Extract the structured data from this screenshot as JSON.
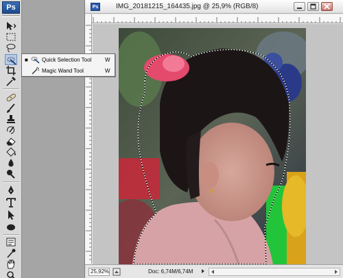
{
  "app": {
    "logo": "Ps"
  },
  "toolbox": {
    "tools": [
      {
        "name": "move-tool",
        "icon": "move-icon"
      },
      {
        "name": "marquee-tool",
        "icon": "rect-marquee-icon"
      },
      {
        "name": "lasso-tool",
        "icon": "lasso-icon"
      },
      {
        "name": "quick-selection-tool",
        "icon": "quick-selection-icon",
        "active": true
      },
      {
        "name": "crop-tool",
        "icon": "crop-icon"
      },
      {
        "name": "eyedropper-tool",
        "icon": "eyedropper-icon"
      },
      {
        "name": "spot-healing-tool",
        "icon": "bandage-icon"
      },
      {
        "name": "brush-tool",
        "icon": "brush-icon"
      },
      {
        "name": "clone-stamp-tool",
        "icon": "stamp-icon"
      },
      {
        "name": "history-brush-tool",
        "icon": "history-brush-icon"
      },
      {
        "name": "eraser-tool",
        "icon": "eraser-icon"
      },
      {
        "name": "paint-bucket-tool",
        "icon": "bucket-icon"
      },
      {
        "name": "blur-tool",
        "icon": "blur-drop-icon"
      },
      {
        "name": "dodge-tool",
        "icon": "dodge-icon"
      },
      {
        "name": "pen-tool",
        "icon": "pen-icon"
      },
      {
        "name": "type-tool",
        "icon": "type-icon"
      },
      {
        "name": "path-selection-tool",
        "icon": "arrow-icon"
      },
      {
        "name": "shape-tool",
        "icon": "ellipse-icon"
      },
      {
        "name": "notes-tool",
        "icon": "note-icon"
      },
      {
        "name": "eyedropper-3d-tool",
        "icon": "dropper-icon"
      },
      {
        "name": "hand-tool",
        "icon": "hand-icon"
      },
      {
        "name": "zoom-tool",
        "icon": "zoom-icon"
      }
    ]
  },
  "flyout": {
    "items": [
      {
        "label": "Quick Selection Tool",
        "shortcut": "W",
        "selected": true,
        "icon": "quick-selection-icon"
      },
      {
        "label": "Magic Wand Tool",
        "shortcut": "W",
        "selected": false,
        "icon": "magic-wand-icon"
      }
    ]
  },
  "document": {
    "title": "IMG_20181215_164435.jpg @ 25,9% (RGB/8)",
    "icon_label": "Ps",
    "controls": [
      "minimize-icon",
      "maximize-icon",
      "close-icon"
    ]
  },
  "statusbar": {
    "zoom": "25,92%",
    "doc_info": "Doc: 6,74M/6,74M"
  },
  "colors": {
    "toolbox_bg": "#d9d9d9",
    "workspace_bg": "#a5a5a5",
    "canvas_bg": "#c4c4c4",
    "active_tool": "#b4c9e6"
  }
}
